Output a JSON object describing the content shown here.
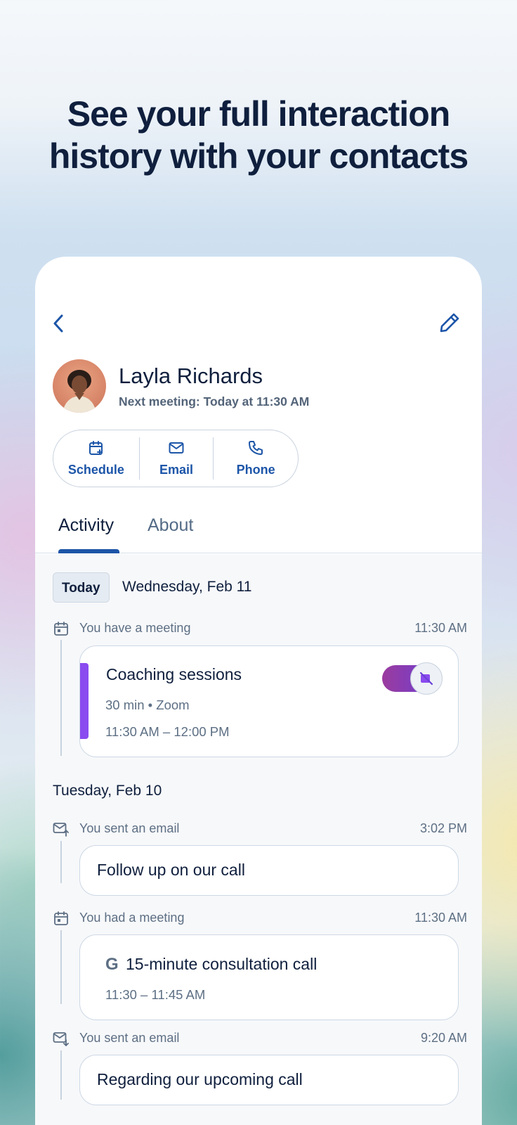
{
  "headline": {
    "line1": "See your full interaction",
    "line2": "history with your contacts"
  },
  "contact": {
    "name": "Layla Richards",
    "next_meeting": "Next meeting: Today at 11:30 AM"
  },
  "actions": {
    "schedule": "Schedule",
    "email": "Email",
    "phone": "Phone"
  },
  "tabs": {
    "activity": "Activity",
    "about": "About",
    "active": "Activity"
  },
  "feed": {
    "today_badge": "Today",
    "today_date": "Wednesday, Feb 11",
    "yesterday_date": "Tuesday, Feb 10",
    "items": [
      {
        "label": "You have a meeting",
        "time": "11:30 AM",
        "title": "Coaching sessions",
        "meta": "30 min • Zoom",
        "range": "11:30 AM – 12:00 PM"
      },
      {
        "label": "You sent an email",
        "time": "3:02 PM",
        "title": "Follow up on our call"
      },
      {
        "label": "You had a meeting",
        "time": "11:30 AM",
        "title": "15-minute consultation call",
        "range": "11:30 – 11:45 AM",
        "provider_icon": "G"
      },
      {
        "label": "You sent an email",
        "time": "9:20 AM",
        "title": "Regarding our upcoming call"
      }
    ]
  },
  "colors": {
    "primary": "#1c55a8",
    "text": "#0f1f3d",
    "muted": "#5d6f84",
    "accent_purple": "#8a4bef"
  }
}
